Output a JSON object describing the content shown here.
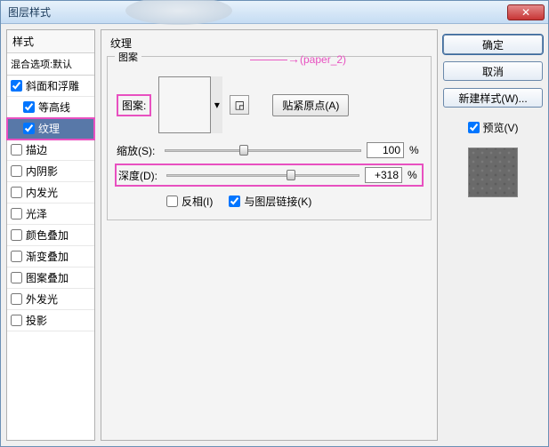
{
  "window": {
    "title": "图层样式"
  },
  "sidebar": {
    "header": "样式",
    "blend_label": "混合选项:默认",
    "items": [
      {
        "label": "斜面和浮雕",
        "checked": true,
        "indent": false
      },
      {
        "label": "等高线",
        "checked": true,
        "indent": true
      },
      {
        "label": "纹理",
        "checked": true,
        "indent": true,
        "selected": true,
        "highlight": true
      },
      {
        "label": "描边",
        "checked": false,
        "indent": false
      },
      {
        "label": "内阴影",
        "checked": false,
        "indent": false
      },
      {
        "label": "内发光",
        "checked": false,
        "indent": false
      },
      {
        "label": "光泽",
        "checked": false,
        "indent": false
      },
      {
        "label": "颜色叠加",
        "checked": false,
        "indent": false
      },
      {
        "label": "渐变叠加",
        "checked": false,
        "indent": false
      },
      {
        "label": "图案叠加",
        "checked": false,
        "indent": false
      },
      {
        "label": "外发光",
        "checked": false,
        "indent": false
      },
      {
        "label": "投影",
        "checked": false,
        "indent": false
      }
    ]
  },
  "main": {
    "section_title": "纹理",
    "fieldset_title": "图案",
    "pattern_label": "图案:",
    "annotation": "(paper_2)",
    "snap_origin": "贴紧原点(A)",
    "scale": {
      "label": "缩放(S):",
      "value": "100",
      "unit": "%",
      "thumb_pct": 38
    },
    "depth": {
      "label": "深度(D):",
      "value": "+318",
      "unit": "%",
      "thumb_pct": 62
    },
    "invert": {
      "label": "反相(I)",
      "checked": false
    },
    "link": {
      "label": "与图层链接(K)",
      "checked": true
    }
  },
  "right": {
    "ok": "确定",
    "cancel": "取消",
    "new_style": "新建样式(W)...",
    "preview_label": "预览(V)",
    "preview_checked": true
  }
}
